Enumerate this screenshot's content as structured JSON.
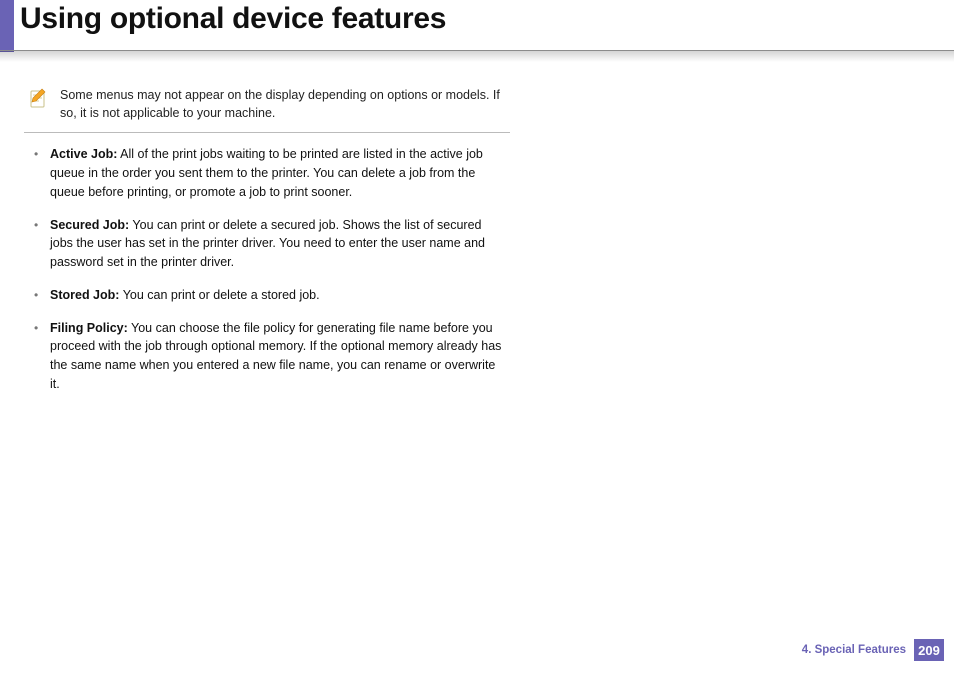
{
  "title": "Using optional device features",
  "note": "Some menus may not appear on the display depending on options or models. If so, it is not applicable to your machine.",
  "items": [
    {
      "term": "Active Job:",
      "desc": "  All of the print jobs waiting to be printed are listed in the active job queue in the order you sent them to the printer. You can delete a job from the queue before printing, or promote a job to print sooner."
    },
    {
      "term": "Secured Job:",
      "desc": " You can print or delete a secured job. Shows the list of secured jobs the user has set in the printer driver. You need to enter the user name and password set in the printer driver."
    },
    {
      "term": "Stored Job:",
      "desc": " You can print or delete a stored job."
    },
    {
      "term": "Filing Policy:",
      "desc": "  You can choose the file policy for generating file name before you proceed with the job through optional memory. If the optional memory already has the same name when you entered a new file name, you can rename or overwrite it."
    }
  ],
  "footer": {
    "chapter": "4.  Special Features",
    "page": "209"
  }
}
